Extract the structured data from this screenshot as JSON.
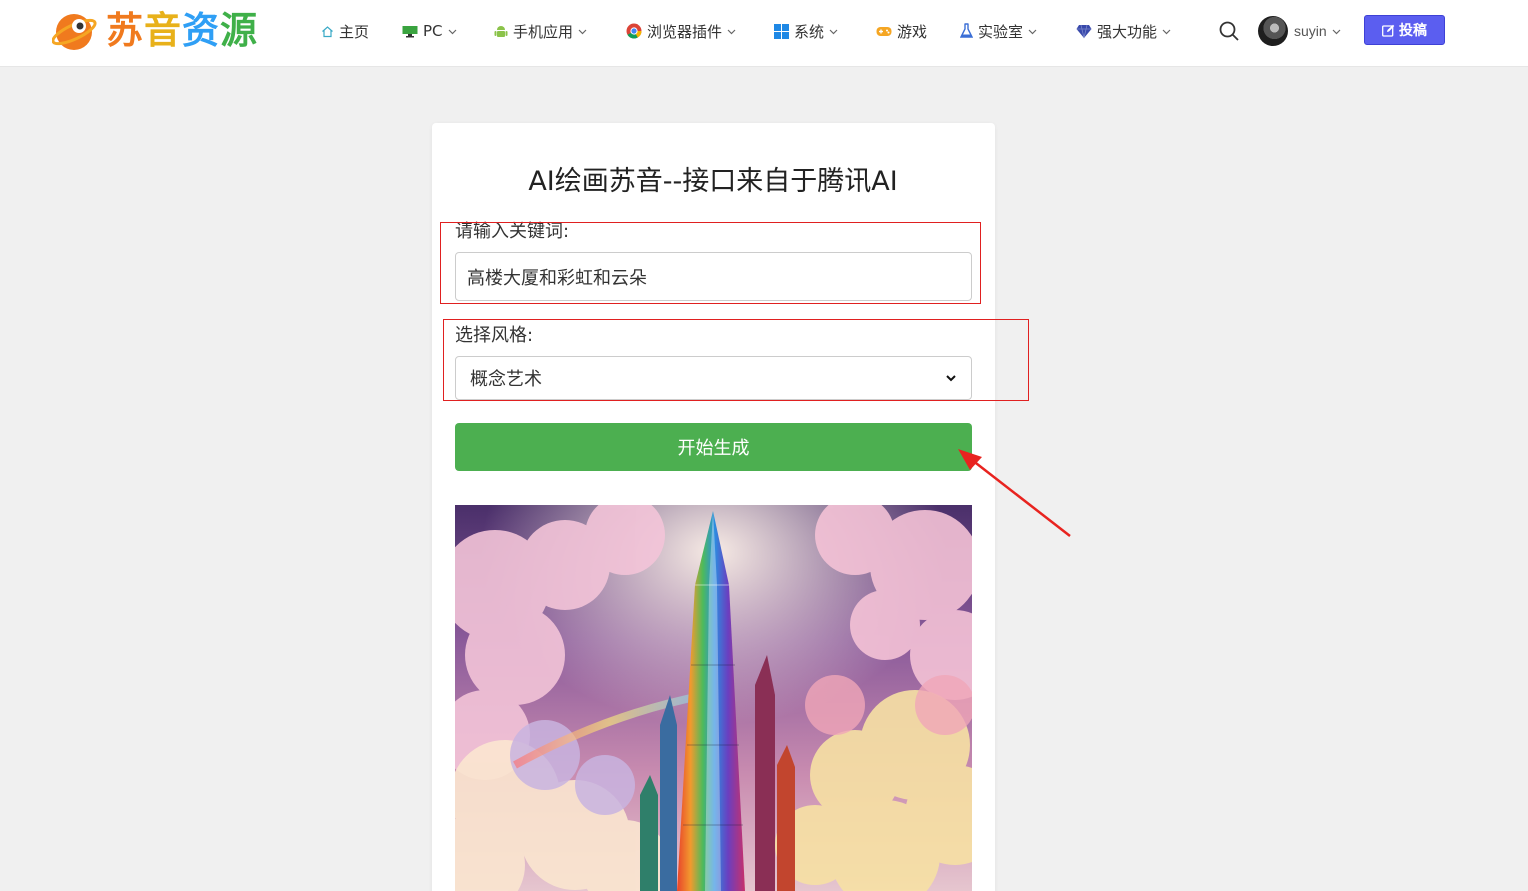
{
  "header": {
    "logo_text": [
      "苏",
      "音",
      "资",
      "源"
    ],
    "nav": [
      {
        "label": "主页",
        "icon": "home-icon",
        "dropdown": false
      },
      {
        "label": "PC",
        "icon": "monitor-icon",
        "dropdown": true
      },
      {
        "label": "手机应用",
        "icon": "android-icon",
        "dropdown": true
      },
      {
        "label": "浏览器插件",
        "icon": "chrome-icon",
        "dropdown": true
      },
      {
        "label": "系统",
        "icon": "windows-icon",
        "dropdown": true
      },
      {
        "label": "游戏",
        "icon": "gamepad-icon",
        "dropdown": false
      },
      {
        "label": "实验室",
        "icon": "flask-icon",
        "dropdown": true
      },
      {
        "label": "强大功能",
        "icon": "gem-icon",
        "dropdown": true
      }
    ],
    "username": "suyin",
    "submit_label": "投稿"
  },
  "main": {
    "title": "AI绘画苏音--接口来自于腾讯AI",
    "keyword_label": "请输入关键词:",
    "keyword_value": "高楼大厦和彩虹和云朵",
    "style_label": "选择风格:",
    "style_value": "概念艺术",
    "generate_label": "开始生成"
  },
  "colors": {
    "accent_blue": "#5b5ef0",
    "generate_green": "#4caf50",
    "annotation_red": "#e02020"
  }
}
